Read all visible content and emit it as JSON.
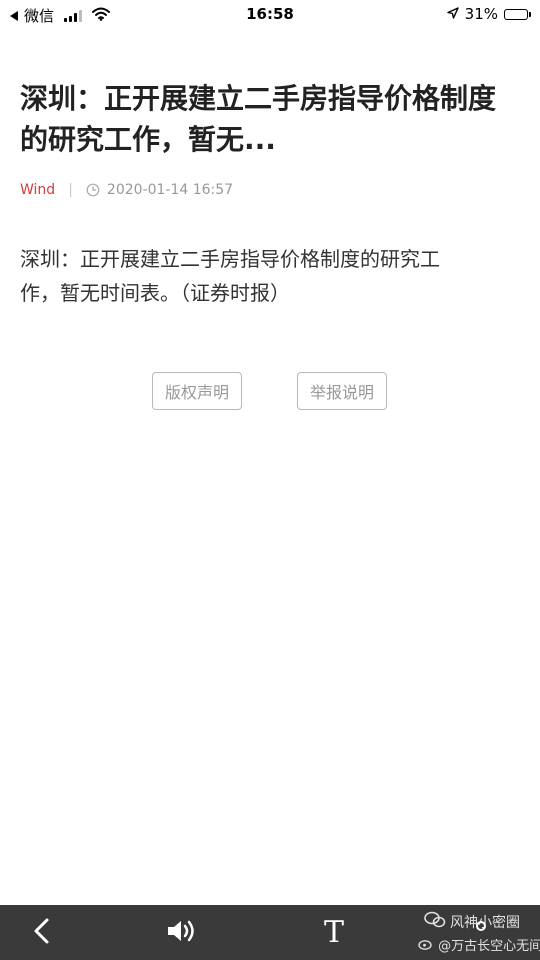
{
  "status_bar": {
    "back_app": "微信",
    "time": "16:58",
    "battery_percent": "31%",
    "battery_level": 0.31
  },
  "article": {
    "headline_line1": "深圳：正开展建立二手房指导价格制度",
    "headline_line2": "的研究工作，暂无...",
    "source": "Wind",
    "separator": "|",
    "datetime": "2020-01-14 16:57",
    "body_line1": "深圳：正开展建立二手房指导价格制度的研究工",
    "body_line2": "作，暂无时间表。（证券时报）"
  },
  "actions": {
    "copyright_label": "版权声明",
    "report_label": "举报说明"
  },
  "toolbar": {
    "font_label": "T"
  },
  "watermark": {
    "line1": "风神小密圈",
    "line2": "@万古长空心无间"
  },
  "icons": {
    "status_back": "back-triangle-icon",
    "signal": "signal-icon",
    "wifi": "wifi-icon",
    "location": "location-arrow-icon",
    "battery": "battery-icon",
    "clock": "clock-icon",
    "toolbar_back": "chevron-left-icon",
    "audio": "speaker-icon",
    "font": "font-size-icon",
    "share": "share-icon",
    "wechat": "wechat-icon",
    "weibo": "weibo-icon"
  },
  "colors": {
    "source_red": "#d93a3a",
    "toolbar_bg": "#3a3a3a",
    "button_border": "#b8b8b8",
    "meta_gray": "#999999"
  }
}
